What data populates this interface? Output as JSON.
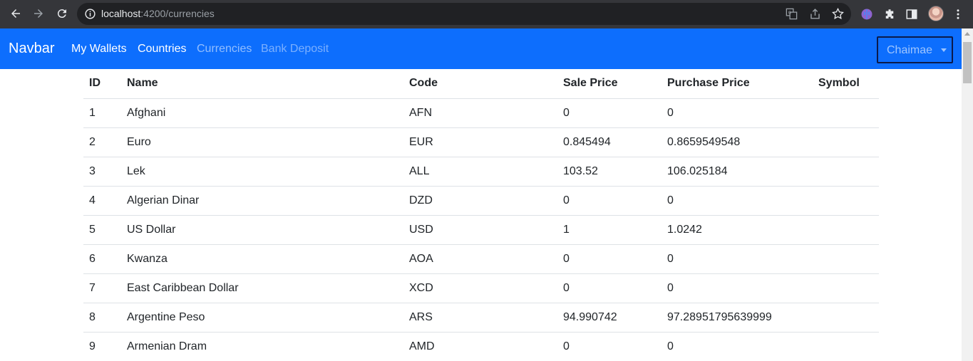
{
  "browser": {
    "url_host": "localhost",
    "url_path": ":4200/currencies",
    "icons": [
      "back-icon",
      "forward-icon",
      "reload-icon",
      "info-icon",
      "translate-icon",
      "share-icon",
      "bookmark-star-icon",
      "extension-brain-icon",
      "puzzle-icon",
      "side-panel-icon",
      "avatar"
    ]
  },
  "navbar": {
    "brand": "Navbar",
    "links": [
      {
        "label": "My Wallets"
      },
      {
        "label": "Countries"
      },
      {
        "label": "Currencies"
      },
      {
        "label": "Bank Deposit"
      }
    ],
    "user": "Chaimae",
    "color": "#0d6efd"
  },
  "table": {
    "headers": [
      "ID",
      "Name",
      "Code",
      "Sale Price",
      "Purchase Price",
      "Symbol"
    ],
    "rows": [
      [
        "1",
        "Afghani",
        "AFN",
        "0",
        "0",
        ""
      ],
      [
        "2",
        "Euro",
        "EUR",
        "0.845494",
        "0.8659549548",
        ""
      ],
      [
        "3",
        "Lek",
        "ALL",
        "103.52",
        "106.025184",
        ""
      ],
      [
        "4",
        "Algerian Dinar",
        "DZD",
        "0",
        "0",
        ""
      ],
      [
        "5",
        "US Dollar",
        "USD",
        "1",
        "1.0242",
        ""
      ],
      [
        "6",
        "Kwanza",
        "AOA",
        "0",
        "0",
        ""
      ],
      [
        "7",
        "East Caribbean Dollar",
        "XCD",
        "0",
        "0",
        ""
      ],
      [
        "8",
        "Argentine Peso",
        "ARS",
        "94.990742",
        "97.28951795639999",
        ""
      ],
      [
        "9",
        "Armenian Dram",
        "AMD",
        "0",
        "0",
        ""
      ]
    ]
  }
}
